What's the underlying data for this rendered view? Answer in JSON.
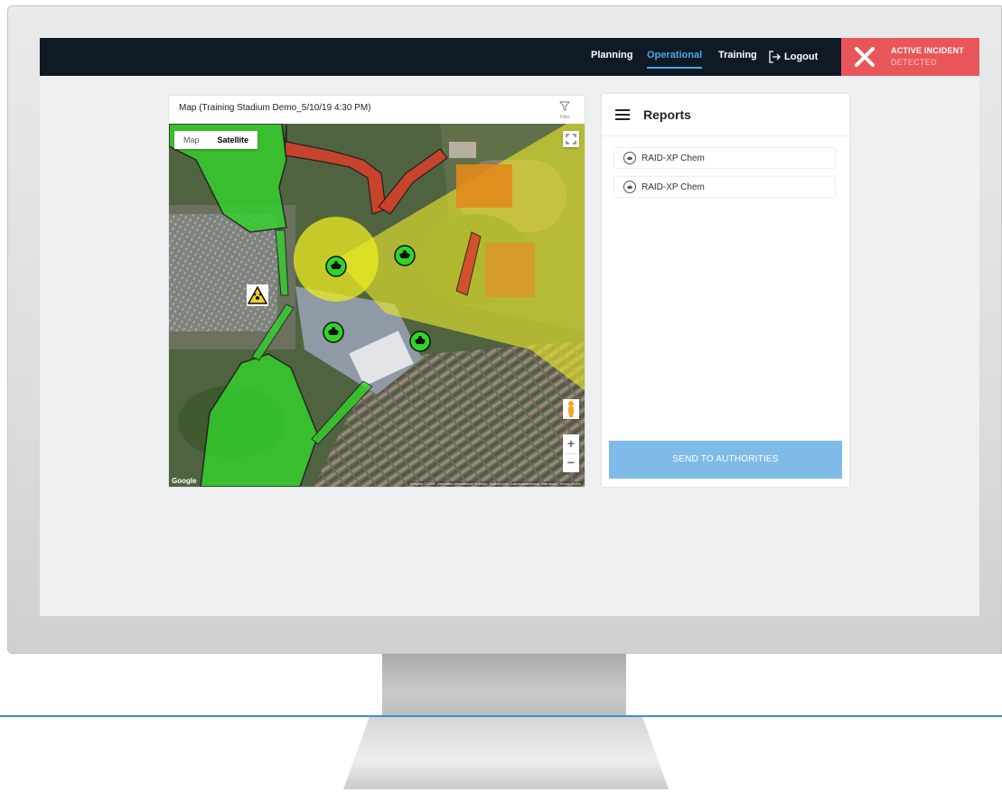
{
  "colors": {
    "topbar": "#0f1a25",
    "nav_active": "#4aa8e8",
    "alert_bg": "#e8565a",
    "send_button": "#7fbbe8",
    "zone_green": "#35d32f",
    "zone_yellow": "#e8e826",
    "zone_red": "#d6402a"
  },
  "nav": {
    "planning": "Planning",
    "operational": "Operational",
    "training": "Training",
    "logout": "Logout",
    "logout_icon": "logout-icon"
  },
  "alert": {
    "icon": "close-icon",
    "line1": "ACTIVE INCIDENT",
    "line2": "DETECTED"
  },
  "map": {
    "title": "Map (Training Stadium Demo_5/10/19 4:30 PM)",
    "filter_label": "Filter",
    "filter_icon": "filter-icon",
    "maptype_map": "Map",
    "maptype_satellite": "Satellite",
    "maptype_selected": "Satellite",
    "zoom_in": "+",
    "zoom_out": "−",
    "google": "Google",
    "attribution": "Imagery ©2019 , Aerodata International Surveys, DigitalGlobe, Landsatsat/Maxar, Stamkory | Terms of Use",
    "markers": {
      "sensor_icon": "gas-mask-sensor-icon",
      "hazard_icon": "hazard-warning-icon"
    }
  },
  "reports": {
    "title": "Reports",
    "menu_icon": "hamburger-menu-icon",
    "items": [
      {
        "label": "RAID-XP Chem",
        "icon": "gas-mask-icon"
      },
      {
        "label": "RAID-XP Chem",
        "icon": "gas-mask-icon"
      }
    ],
    "send_button": "SEND TO AUTHORITIES"
  }
}
